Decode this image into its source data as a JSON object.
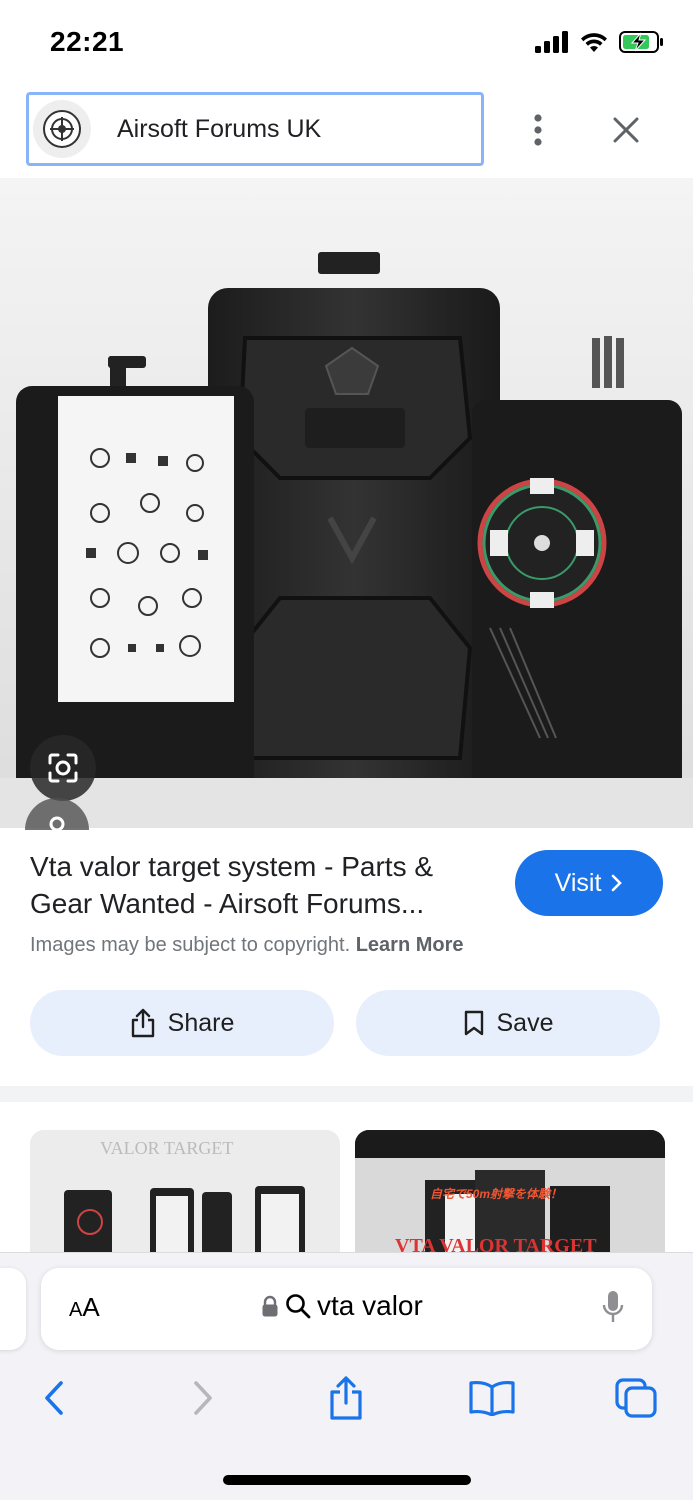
{
  "status": {
    "time": "22:21"
  },
  "header": {
    "source_title": "Airsoft Forums UK"
  },
  "result": {
    "title": "Vta valor target system - Parts & Gear Wanted - Airsoft Forums...",
    "visit_label": "Visit",
    "copyright_text": "Images may be subject to copyright.",
    "learn_more": "Learn More"
  },
  "actions": {
    "share_label": "Share",
    "save_label": "Save"
  },
  "thumbnails": [
    {
      "caption": "VALOR TARGET"
    },
    {
      "caption": "VTA VALOR TARGET"
    }
  ],
  "browser": {
    "text_size_label_small": "A",
    "text_size_label_large": "A",
    "address_text": "vta valor"
  },
  "colors": {
    "accent": "#1a73e8",
    "chip_bg": "#e8effc",
    "source_border": "#8ab4f8"
  }
}
